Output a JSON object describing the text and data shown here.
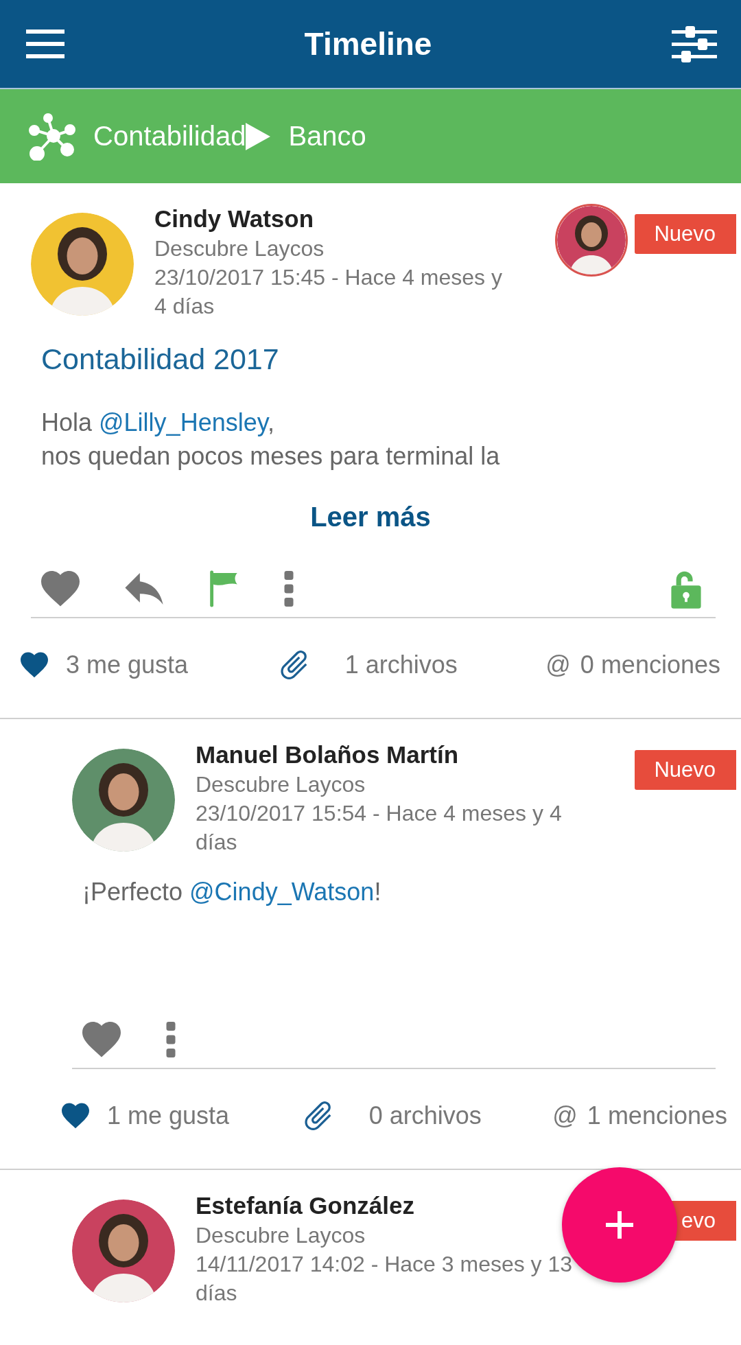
{
  "top_bar": {
    "title": "Timeline"
  },
  "categories": [
    {
      "kind": "network",
      "label": "Contabilidad"
    },
    {
      "kind": "play",
      "label": "Banco"
    }
  ],
  "posts": [
    {
      "kind": "post",
      "avatar": {
        "kind": "picture"
      },
      "author": "Cindy Watson",
      "group": "Descubre Laycos",
      "date": "23/10/2017 15:45 - Hace 4 meses y 4 días",
      "assignee": {
        "kind": "picture"
      },
      "badge": "Nuevo",
      "title": "Contabilidad 2017",
      "body": [
        [
          {
            "kind": "text",
            "text": "Hola "
          },
          {
            "kind": "mention",
            "text": "@Lilly_Hensley"
          },
          {
            "kind": "text",
            "text": ","
          }
        ],
        [
          {
            "kind": "text",
            "text": "nos quedan pocos meses para terminal la"
          }
        ]
      ],
      "read_more": "Leer más",
      "actions": [
        {
          "kind": "like"
        },
        {
          "kind": "reply"
        },
        {
          "kind": "flag"
        },
        {
          "kind": "more"
        },
        {
          "kind": "lock"
        }
      ],
      "stats": [
        {
          "kind": "likes",
          "text": "3 me gusta"
        },
        {
          "kind": "files",
          "text": "1 archivos"
        },
        {
          "kind": "mentions",
          "icon": "@",
          "text": "0 menciones"
        }
      ]
    },
    {
      "kind": "reply",
      "avatar": {
        "kind": "picture"
      },
      "author": "Manuel Bolaños Martín",
      "group": "Descubre Laycos",
      "date": "23/10/2017 15:54 - Hace 4 meses y 4 días",
      "badge": "Nuevo",
      "body": [
        [
          {
            "kind": "text",
            "text": "¡Perfecto "
          },
          {
            "kind": "mention",
            "text": "@Cindy_Watson"
          },
          {
            "kind": "text",
            "text": "!"
          }
        ]
      ],
      "actions": [
        {
          "kind": "like"
        },
        {
          "kind": "more"
        }
      ],
      "stats": [
        {
          "kind": "likes",
          "text": "1 me gusta"
        },
        {
          "kind": "files",
          "text": "0 archivos"
        },
        {
          "kind": "mentions",
          "icon": "@",
          "text": "1 menciones"
        }
      ]
    },
    {
      "kind": "reply",
      "avatar": {
        "kind": "picture"
      },
      "author": "Estefanía González",
      "group": "Descubre Laycos",
      "date": "14/11/2017 14:02 - Hace 3 meses y 13 días",
      "badge": "evo"
    }
  ],
  "fab": {
    "kind": "add"
  }
}
